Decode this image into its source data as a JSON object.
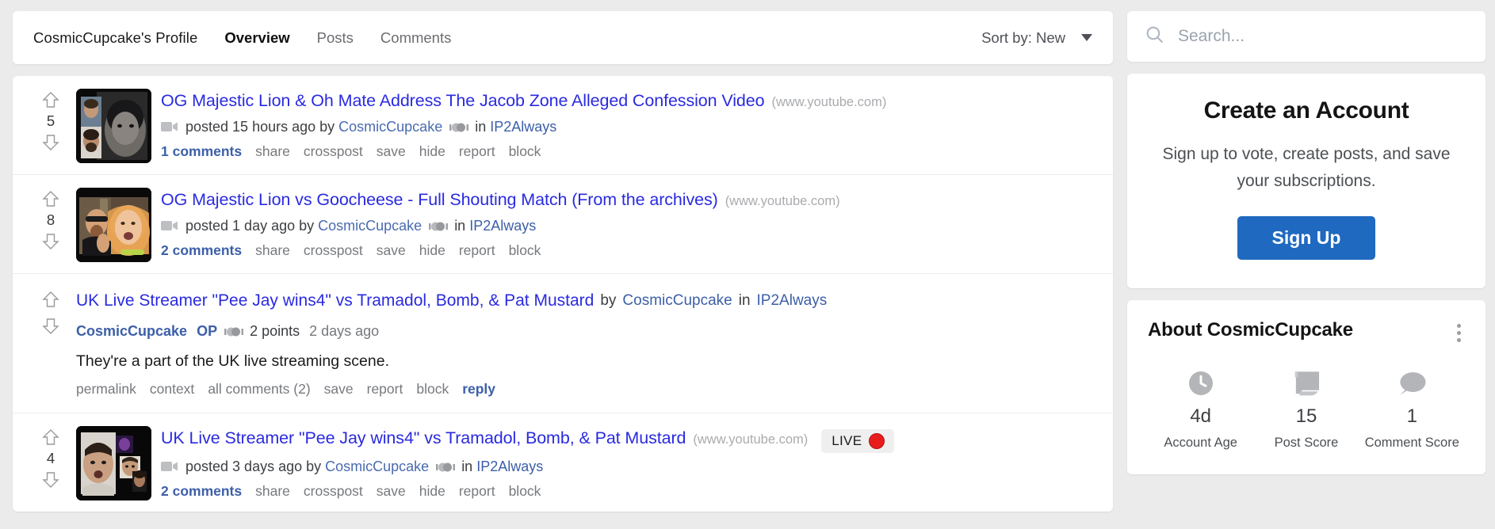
{
  "header": {
    "profile_name": "CosmicCupcake's Profile",
    "tabs": [
      {
        "label": "Overview",
        "active": true
      },
      {
        "label": "Posts",
        "active": false
      },
      {
        "label": "Comments",
        "active": false
      }
    ],
    "sort": {
      "label": "Sort by: New",
      "icon": "chevron-down-icon"
    }
  },
  "feed": [
    {
      "kind": "post",
      "score": "5",
      "title": "OG Majestic Lion & Oh Mate Address The Jacob Zone Alleged Confession Video",
      "domain": "(www.youtube.com)",
      "posted": "posted 15 hours ago by",
      "author": "CosmicCupcake",
      "in_word": "in",
      "community": "IP2Always",
      "comments": "1 comments",
      "actions": [
        "share",
        "crosspost",
        "save",
        "hide",
        "report",
        "block"
      ],
      "live": null
    },
    {
      "kind": "post",
      "score": "8",
      "title": "OG Majestic Lion vs Goocheese - Full Shouting Match (From the archives)",
      "domain": "(www.youtube.com)",
      "posted": "posted 1 day ago by",
      "author": "CosmicCupcake",
      "in_word": "in",
      "community": "IP2Always",
      "comments": "2 comments",
      "actions": [
        "share",
        "crosspost",
        "save",
        "hide",
        "report",
        "block"
      ],
      "live": null
    },
    {
      "kind": "comment",
      "score": "",
      "title": "UK Live Streamer \"Pee Jay wins4\" vs Tramadol, Bomb, & Pat Mustard",
      "by_word": "by",
      "author": "CosmicCupcake",
      "in_word": "in",
      "community": "IP2Always",
      "comment_author": "CosmicCupcake",
      "op_badge": "OP",
      "points": "2 points",
      "time": "2 days ago",
      "body": "They're a part of the UK live streaming scene.",
      "actions": [
        "permalink",
        "context",
        "all comments (2)",
        "save",
        "report",
        "block"
      ],
      "reply": "reply"
    },
    {
      "kind": "post",
      "score": "4",
      "title": "UK Live Streamer \"Pee Jay wins4\" vs Tramadol, Bomb, & Pat Mustard",
      "domain": "(www.youtube.com)",
      "posted": "posted 3 days ago by",
      "author": "CosmicCupcake",
      "in_word": "in",
      "community": "IP2Always",
      "comments": "2 comments",
      "actions": [
        "share",
        "crosspost",
        "save",
        "hide",
        "report",
        "block"
      ],
      "live": {
        "label": "LIVE",
        "dot_color": "#e71d1d"
      }
    }
  ],
  "sidebar": {
    "search": {
      "placeholder": "Search...",
      "value": "",
      "icon": "search-icon"
    },
    "signup": {
      "title": "Create an Account",
      "subtitle": "Sign up to vote, create posts, and save your subscriptions.",
      "button": "Sign Up",
      "button_color": "#1f69c0"
    },
    "about": {
      "title": "About CosmicCupcake",
      "menu_icon": "kebab-menu-icon",
      "stats": [
        {
          "icon": "clock-icon",
          "value": "4d",
          "label": "Account Age"
        },
        {
          "icon": "scroll-icon",
          "value": "15",
          "label": "Post Score"
        },
        {
          "icon": "comment-bubble-icon",
          "value": "1",
          "label": "Comment Score"
        }
      ]
    }
  }
}
